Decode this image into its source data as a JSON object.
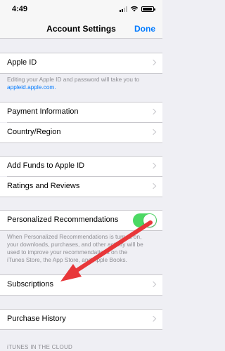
{
  "status_bar": {
    "time": "4:49"
  },
  "nav": {
    "title": "Account Settings",
    "done_label": "Done"
  },
  "apple_id": {
    "label": "Apple ID",
    "footnote": "Editing your Apple ID and password will take you to",
    "footnote_link": "appleid.apple.com."
  },
  "section2": {
    "payment_label": "Payment Information",
    "country_label": "Country/Region"
  },
  "section3": {
    "add_funds_label": "Add Funds to Apple ID",
    "ratings_label": "Ratings and Reviews"
  },
  "personalized": {
    "label": "Personalized Recommendations",
    "enabled": true,
    "footnote_lines": [
      "When Personalized Recommendations is turned on,",
      "your downloads, purchases, and other activity will be",
      "used to improve your recommendations on the",
      "iTunes Store, the App Store, and Apple Books."
    ]
  },
  "subscriptions": {
    "label": "Subscriptions"
  },
  "purchase_history": {
    "label": "Purchase History"
  },
  "section_header_itunes": "iTUNES IN THE CLOUD",
  "colors": {
    "accent": "#007aff",
    "toggle_on": "#4cd964",
    "annotation_arrow": "#e8373a",
    "background": "#efeff4"
  }
}
